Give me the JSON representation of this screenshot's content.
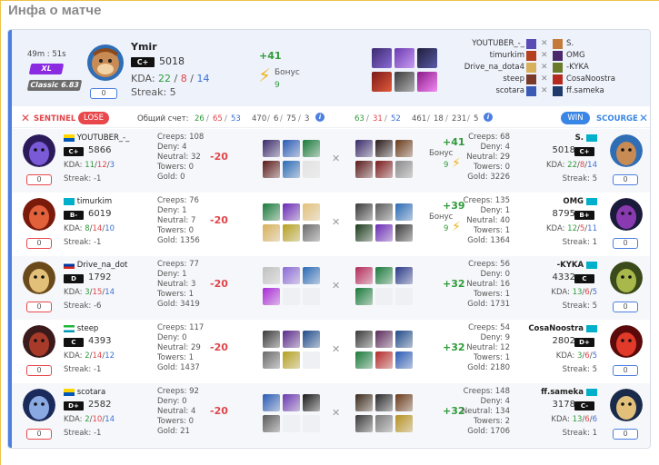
{
  "page": {
    "title": "Инфа о матче"
  },
  "colors": {
    "accent": "#4b7fe0",
    "win": "#3a86e6",
    "lose": "#e8484c",
    "kills": "#2e9c3a",
    "deaths": "#e0454a",
    "assists": "#3a6fd8",
    "bonus": "#f2b21c"
  },
  "header": {
    "duration": "49m : 51s",
    "tier_badge": "XL",
    "mode_badge": "Classic 6.83",
    "reward_count": "0",
    "player": {
      "name": "Ymir",
      "rank": "C+",
      "mmr": "5018",
      "kda_label": "KDA:",
      "kills": "22",
      "deaths": "8",
      "assists": "14",
      "sep": "/",
      "streak": "Streak: 5"
    },
    "delta": "+41",
    "bonus_label": "Бонус",
    "bonus_value": "9",
    "lineup": [
      {
        "left": "YOUTUBER_-_",
        "right": "S."
      },
      {
        "left": "timurkim",
        "right": "OMG"
      },
      {
        "left": "Drive_na_dota4",
        "right": "-KYKA"
      },
      {
        "left": "steep",
        "right": "CosaNoostra"
      },
      {
        "left": "scotara",
        "right": "ff.sameka"
      }
    ]
  },
  "scorebar": {
    "sentinel": "SENTINEL",
    "lose": "LOSE",
    "total_label": "Общий счет:",
    "left": {
      "k": "26",
      "d": "65",
      "a": "53",
      "sep": "/",
      "towers": "470",
      "rax": "6",
      "tr": "75",
      "x": "3"
    },
    "right": {
      "k": "63",
      "d": "31",
      "a": "52",
      "towers": "461",
      "rax": "18",
      "tr": "231",
      "x": "5"
    },
    "win": "WIN",
    "scourge": "SCOURGE"
  },
  "labels": {
    "kda": "KDA:",
    "streak": "Streak:",
    "creeps": "Creeps:",
    "deny": "Deny:",
    "neutral": "Neutral:",
    "towers": "Towers:",
    "gold": "Gold:",
    "bonus": "Бонус"
  },
  "rows": [
    {
      "left": {
        "name": "YOUTUBER_-_",
        "rank": "C+",
        "mmr": "5866",
        "k": "11",
        "d": "12",
        "a": "3",
        "streak": "-1",
        "creeps": "108",
        "deny": "4",
        "neutral": "32",
        "towers": "0",
        "gold": "0",
        "delta": "-20",
        "zero": "0"
      },
      "right": {
        "name": "S.",
        "rank": "C+",
        "mmr": "5018",
        "k": "22",
        "d": "8",
        "a": "14",
        "streak": "5",
        "creeps": "68",
        "deny": "4",
        "neutral": "29",
        "towers": "0",
        "gold": "3226",
        "delta": "+41",
        "bonus": "9",
        "zero": "0"
      }
    },
    {
      "left": {
        "name": "timurkim",
        "rank": "B-",
        "mmr": "6019",
        "k": "8",
        "d": "14",
        "a": "10",
        "streak": "-1",
        "creeps": "76",
        "deny": "1",
        "neutral": "7",
        "towers": "0",
        "gold": "1356",
        "delta": "-20",
        "zero": "0"
      },
      "right": {
        "name": "OMG",
        "rank": "B+",
        "mmr": "8795",
        "k": "12",
        "d": "5",
        "a": "11",
        "streak": "1",
        "creeps": "135",
        "deny": "1",
        "neutral": "40",
        "towers": "1",
        "gold": "1364",
        "delta": "+39",
        "bonus": "9",
        "zero": "0"
      }
    },
    {
      "left": {
        "name": "Drive_na_dot",
        "rank": "D",
        "mmr": "1792",
        "k": "3",
        "d": "15",
        "a": "14",
        "streak": "-6",
        "creeps": "77",
        "deny": "1",
        "neutral": "3",
        "towers": "1",
        "gold": "3419",
        "delta": "-20",
        "zero": "0"
      },
      "right": {
        "name": "-KYKA",
        "rank": "C",
        "mmr": "4332",
        "k": "13",
        "d": "6",
        "a": "5",
        "streak": "5",
        "creeps": "56",
        "deny": "0",
        "neutral": "16",
        "towers": "1",
        "gold": "1731",
        "delta": "+32",
        "zero": "0"
      }
    },
    {
      "left": {
        "name": "steep",
        "rank": "C",
        "mmr": "4393",
        "k": "2",
        "d": "14",
        "a": "12",
        "streak": "-1",
        "creeps": "117",
        "deny": "0",
        "neutral": "29",
        "towers": "1",
        "gold": "1437",
        "delta": "-20",
        "zero": "0"
      },
      "right": {
        "name": "CosaNoostra",
        "rank": "D+",
        "mmr": "2802",
        "k": "3",
        "d": "6",
        "a": "5",
        "streak": "5",
        "creeps": "54",
        "deny": "9",
        "neutral": "12",
        "towers": "1",
        "gold": "2180",
        "delta": "+32",
        "zero": "0"
      }
    },
    {
      "left": {
        "name": "scotara",
        "rank": "D+",
        "mmr": "2582",
        "k": "2",
        "d": "10",
        "a": "14",
        "streak": "-1",
        "creeps": "92",
        "deny": "0",
        "neutral": "4",
        "towers": "0",
        "gold": "21",
        "delta": "-20",
        "zero": "0"
      },
      "right": {
        "name": "ff.sameka",
        "rank": "C-",
        "mmr": "3178",
        "k": "13",
        "d": "6",
        "a": "6",
        "streak": "1",
        "creeps": "148",
        "deny": "4",
        "neutral": "134",
        "towers": "2",
        "gold": "1706",
        "delta": "+32",
        "zero": "0"
      }
    }
  ]
}
